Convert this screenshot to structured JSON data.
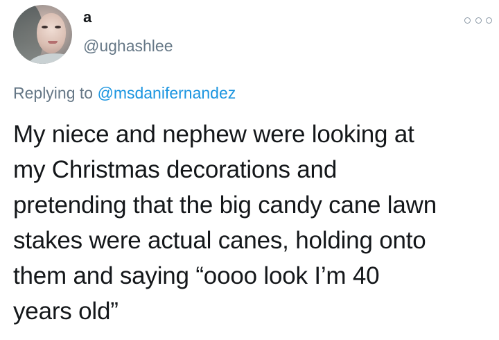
{
  "author": {
    "display_name": "a",
    "handle": "@ughashlee"
  },
  "reply": {
    "prefix": "Replying to",
    "to_handle": "@msdanifernandez"
  },
  "tweet": {
    "text": "My niece and nephew were looking at\nmy Christmas decorations and\npretending that the big candy cane lawn\nstakes were actual canes, holding onto\nthem and saying “oooo look I’m 40\nyears old”"
  },
  "icons": {
    "more": "more-options-icon",
    "avatar": "avatar-photo"
  },
  "colors": {
    "text": "#14171a",
    "secondary": "#657786",
    "link": "#1b95e0",
    "background": "#ffffff"
  }
}
